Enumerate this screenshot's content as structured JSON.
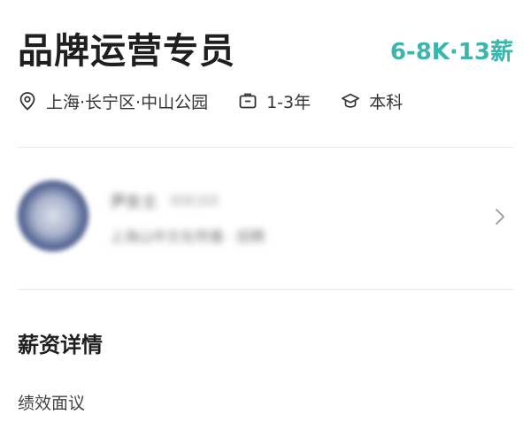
{
  "job": {
    "title": "品牌运营专员",
    "salary": "6-8K·13薪"
  },
  "meta": {
    "location": "上海·长宁区·中山公园",
    "experience": "1-3年",
    "education": "本科",
    "location_icon": "location-pin-icon",
    "experience_icon": "briefcase-icon",
    "education_icon": "graduation-cap-icon"
  },
  "recruiter": {
    "name": "尹女士",
    "status": "刚刚活跃",
    "company": "上海山中文化传播 · 招聘",
    "avatar_icon": "avatar",
    "arrow_icon": "chevron-right-icon"
  },
  "salary_section": {
    "title": "薪资详情",
    "detail": "绩效面议"
  },
  "colors": {
    "accent": "#3bb6ad",
    "text_primary": "#1f1f1f",
    "divider": "#e8e8e8"
  }
}
